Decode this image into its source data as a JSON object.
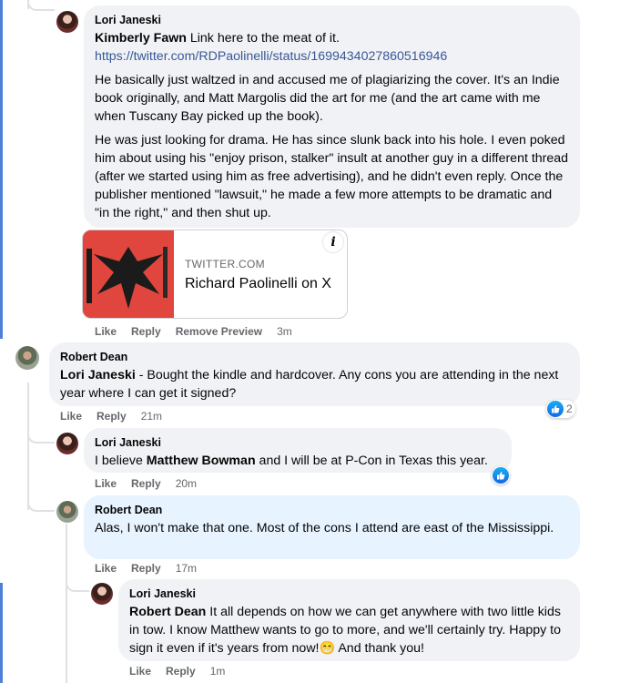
{
  "comments": [
    {
      "author": "Lori Janeski",
      "mention": "Kimberly Fawn",
      "first_line": " Link here to the meat of it.",
      "link": "https://twitter.com/RDPaolinelli/status/1699434027860516946",
      "paragraphs": [
        "He basically just waltzed in and accused me of plagiarizing the cover. It's an Indie book originally, and Matt Margolis did the art for me (and the art came with me when Tuscany Bay picked up the book).",
        "He was just looking for drama. He has since slunk back into his hole. I even poked him about using his \"enjoy prison, stalker\" insult at another guy in a different thread (after we started using him as free advertising), and he didn't even reply. Once the publisher mentioned \"lawsuit,\" he made a few more attempts to be dramatic and \"in the right,\" and then shut up."
      ],
      "preview": {
        "domain": "TWITTER.COM",
        "title": "Richard Paolinelli on X",
        "info": "i"
      },
      "actions": {
        "like": "Like",
        "reply": "Reply",
        "remove": "Remove Preview",
        "time": "3m"
      }
    },
    {
      "author": "Robert Dean",
      "mention": "Lori Janeski",
      "text": " - Bought the kindle and hardcover. Any cons you are attending in the next year where I can get it signed?",
      "reaction_count": "2",
      "actions": {
        "like": "Like",
        "reply": "Reply",
        "time": "21m"
      }
    },
    {
      "author": "Lori Janeski",
      "prefix": "I believe ",
      "mention": "Matthew Bowman",
      "text": " and I will be at P-Con in Texas this year.",
      "actions": {
        "like": "Like",
        "reply": "Reply",
        "time": "20m"
      }
    },
    {
      "author": "Robert Dean",
      "text": "Alas, I won't make that one. Most of the cons I attend are east of the Mississippi.",
      "actions": {
        "like": "Like",
        "reply": "Reply",
        "time": "17m"
      }
    },
    {
      "author": "Lori Janeski",
      "mention": "Robert Dean",
      "text": " It all depends on how we can get anywhere with two little kids in tow. I know Matthew wants to go to more, and we'll certainly try. Happy to sign it even if it's years from now!",
      "emoji": "😁",
      "text_end": " And thank you!",
      "actions": {
        "like": "Like",
        "reply": "Reply",
        "time": "1m"
      }
    }
  ],
  "icons": {
    "avatar_lori": "avatar-lori-icon",
    "avatar_robert": "avatar-robert-icon",
    "like_reaction": "thumbs-up-icon",
    "info": "info-icon"
  },
  "colors": {
    "bubble": "#f0f2f5",
    "bubble_highlight": "#e7f3ff",
    "link": "#385898",
    "like_blue": "#1877f2"
  }
}
